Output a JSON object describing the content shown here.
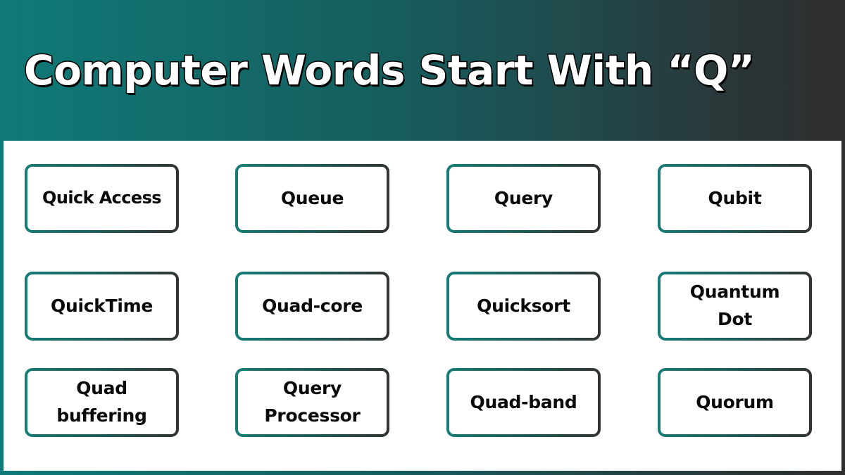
{
  "header": {
    "title": "Computer Words Start With “Q”"
  },
  "colors": {
    "teal": "#0f7a78",
    "dark": "#2f2f2f",
    "card_background": "#ffffff",
    "text": "#0a0a0a"
  },
  "words": [
    {
      "label": "Quick Access"
    },
    {
      "label": "Queue"
    },
    {
      "label": "Query"
    },
    {
      "label": "Qubit"
    },
    {
      "label": "QuickTime"
    },
    {
      "label": "Quad-core"
    },
    {
      "label": "Quicksort"
    },
    {
      "label": "Quantum Dot"
    },
    {
      "label": "Quad buffering"
    },
    {
      "label": "Query Processor"
    },
    {
      "label": "Quad-band"
    },
    {
      "label": "Quorum"
    }
  ]
}
